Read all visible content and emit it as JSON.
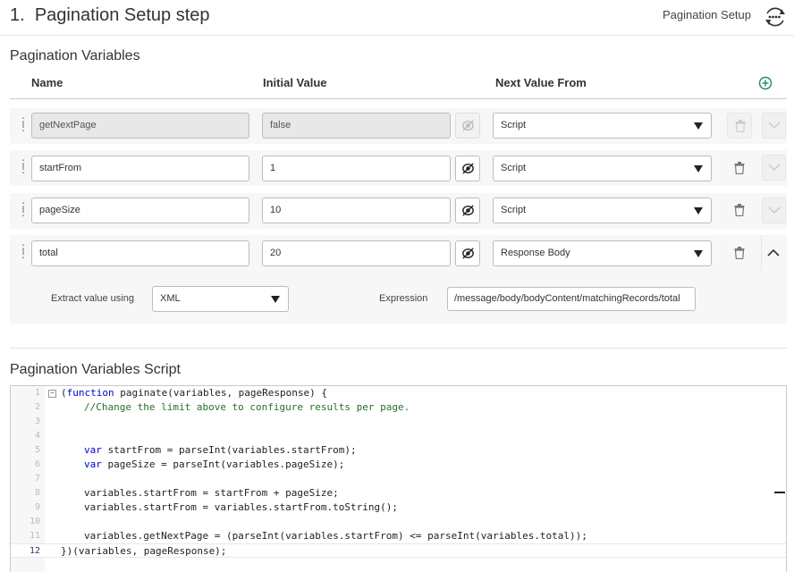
{
  "header": {
    "step_number": "1.",
    "step_title": "Pagination Setup step",
    "right_label": "Pagination Setup",
    "right_icon": "pagination-cycle-icon"
  },
  "variables_section": {
    "title": "Pagination Variables",
    "columns": {
      "name": "Name",
      "initial": "Initial Value",
      "next": "Next Value From"
    },
    "add_icon": "plus-circle-icon",
    "accent_color": "#1a8a6b"
  },
  "rows": [
    {
      "name": "getNextPage",
      "initial": "false",
      "next": "Script",
      "disabled": true,
      "expanded": false
    },
    {
      "name": "startFrom",
      "initial": "1",
      "next": "Script",
      "disabled": false,
      "expanded": false
    },
    {
      "name": "pageSize",
      "initial": "10",
      "next": "Script",
      "disabled": false,
      "expanded": false
    },
    {
      "name": "total",
      "initial": "20",
      "next": "Response Body",
      "disabled": false,
      "expanded": true
    }
  ],
  "extract": {
    "label": "Extract value using",
    "method": "XML",
    "expression_label": "Expression",
    "expression": "/message/body/bodyContent/matchingRecords/total"
  },
  "script_section": {
    "title": "Pagination Variables Script",
    "active_line": 12,
    "lines": [
      "(function paginate(variables, pageResponse) {",
      "    //Change the limit above to configure results per page.",
      "",
      "",
      "    var startFrom = parseInt(variables.startFrom);",
      "    var pageSize = parseInt(variables.pageSize);",
      "",
      "    variables.startFrom = startFrom + pageSize;",
      "    variables.startFrom = variables.startFrom.toString();",
      "",
      "    variables.getNextPage = (parseInt(variables.startFrom) <= parseInt(variables.total));",
      "})(variables, pageResponse);"
    ],
    "line_numbers": [
      "1",
      "2",
      "3",
      "4",
      "5",
      "6",
      "7",
      "8",
      "9",
      "10",
      "11",
      "12"
    ]
  }
}
